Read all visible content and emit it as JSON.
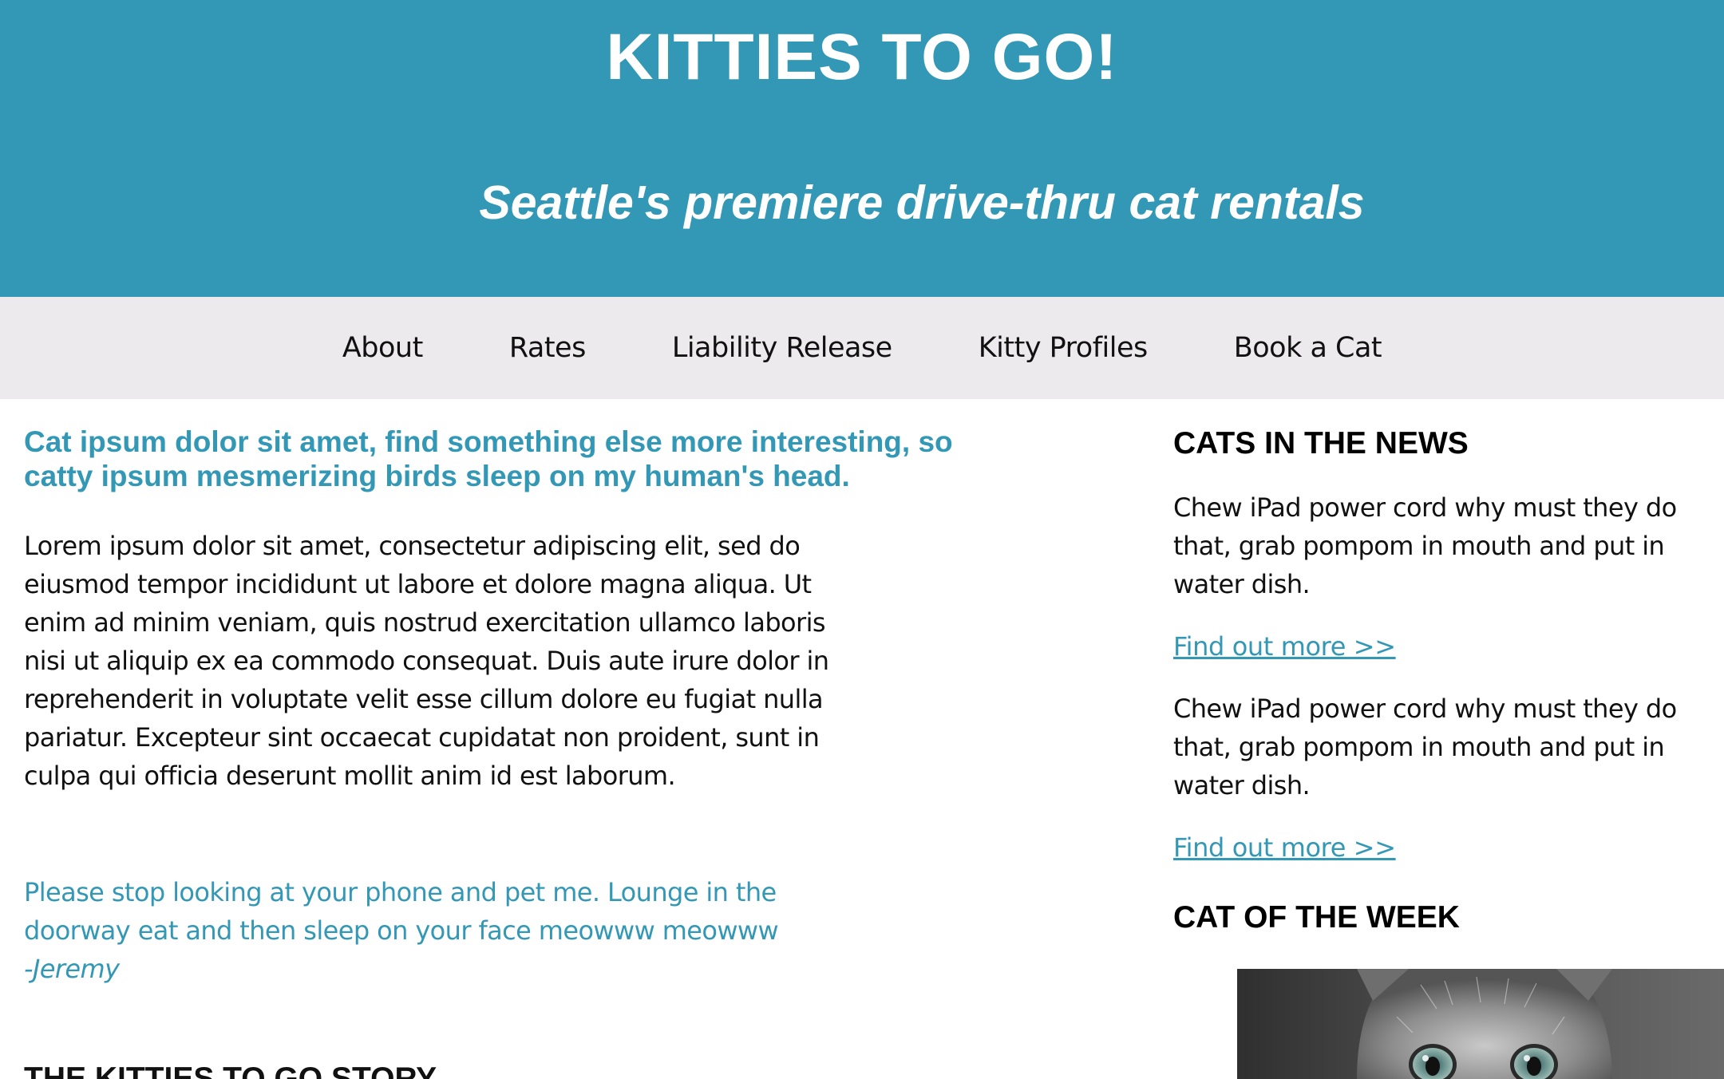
{
  "header": {
    "title": "KITTIES TO GO!",
    "tagline": "Seattle's premiere drive-thru cat rentals",
    "background_color": "#3398b5"
  },
  "nav": {
    "items": [
      {
        "label": "About"
      },
      {
        "label": "Rates"
      },
      {
        "label": "Liability Release"
      },
      {
        "label": "Kitty Profiles"
      },
      {
        "label": "Book a Cat"
      }
    ],
    "background_color": "#eceaec"
  },
  "main": {
    "intro_heading": "Cat ipsum dolor sit amet, find something else more interesting, so catty ipsum mesmerizing birds sleep on my human's head.",
    "intro_body": "Lorem ipsum dolor sit amet, consectetur adipiscing elit, sed do eiusmod tempor incididunt ut labore et dolore magna aliqua. Ut enim ad minim veniam, quis nostrud exercitation ullamco laboris nisi ut aliquip ex ea commodo consequat. Duis aute irure dolor in reprehenderit in voluptate velit esse cillum dolore eu fugiat nulla pariatur. Excepteur sint occaecat cupidatat non proident, sunt in culpa qui officia deserunt mollit anim id est laborum.",
    "quote_text": "Please stop looking at your phone and pet me. Lounge in the doorway eat and then sleep on your face meowww meowww",
    "quote_author": "-Jeremy",
    "story_heading": "THE KITTIES TO GO STORY",
    "accent_color": "#3398b5"
  },
  "sidebar": {
    "news_heading": "CATS IN THE NEWS",
    "news_items": [
      {
        "text": "Chew iPad power cord why must they do that, grab pompom in mouth and put in water dish.",
        "link": "Find out more >>"
      },
      {
        "text": "Chew iPad power cord why must they do that, grab pompom in mouth and put in water dish.",
        "link": "Find out more >>"
      }
    ],
    "cat_of_week_heading": "CAT OF THE WEEK",
    "cat_photo_icon": "kitten-photo"
  }
}
